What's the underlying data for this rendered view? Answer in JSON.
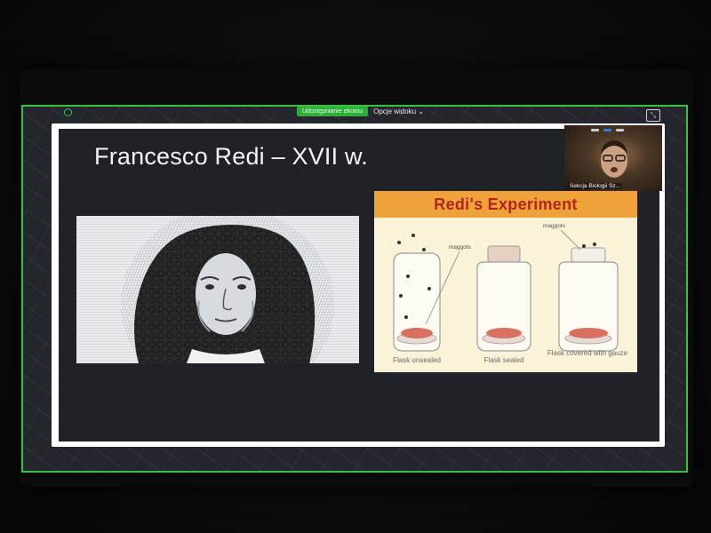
{
  "share_toolbar": {
    "sharing_label": "Udostępnianie ekranu",
    "view_options_label": "Opcje widoku ⌄"
  },
  "slide": {
    "title": "Francesco Redi – XVII w."
  },
  "experiment": {
    "title": "Redi's Experiment",
    "maggots_label_1": "maggots",
    "maggots_label_2": "maggots",
    "captions": [
      "Flask unsealed",
      "Flask sealed",
      "Flask covered with gauze"
    ]
  },
  "video": {
    "participant_name": "Sekcja Biologii Sz..."
  },
  "colors": {
    "share_border": "#39c23f",
    "header_orange": "#f0a23a",
    "title_red": "#b3241d"
  }
}
